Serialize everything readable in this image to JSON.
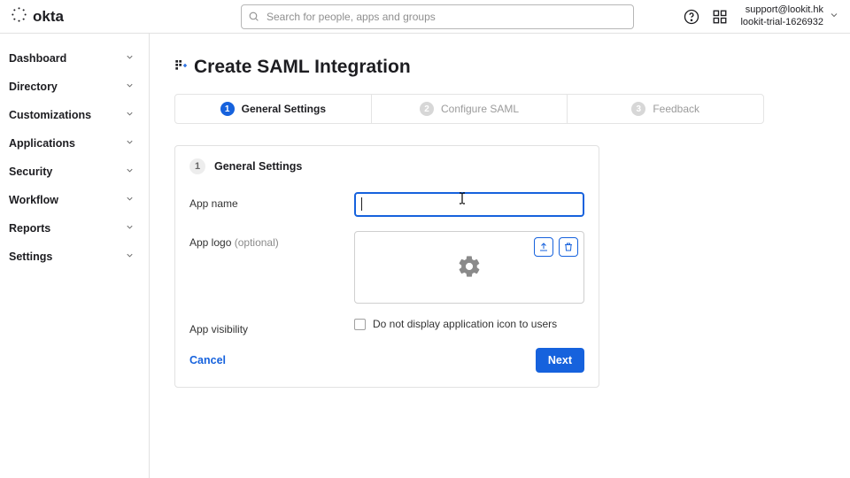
{
  "brand": "okta",
  "search": {
    "placeholder": "Search for people, apps and groups"
  },
  "user": {
    "email": "support@lookit.hk",
    "tenant": "lookit-trial-1626932"
  },
  "sidebar": {
    "items": [
      {
        "label": "Dashboard"
      },
      {
        "label": "Directory"
      },
      {
        "label": "Customizations"
      },
      {
        "label": "Applications"
      },
      {
        "label": "Security"
      },
      {
        "label": "Workflow"
      },
      {
        "label": "Reports"
      },
      {
        "label": "Settings"
      }
    ]
  },
  "page": {
    "title": "Create SAML Integration"
  },
  "stepper": {
    "steps": [
      {
        "num": "1",
        "label": "General Settings",
        "active": true
      },
      {
        "num": "2",
        "label": "Configure SAML",
        "active": false
      },
      {
        "num": "3",
        "label": "Feedback",
        "active": false
      }
    ]
  },
  "form": {
    "section_num": "1",
    "section_title": "General Settings",
    "app_name_label": "App name",
    "app_name_value": "",
    "app_logo_label": "App logo",
    "app_logo_hint": "(optional)",
    "app_visibility_label": "App visibility",
    "app_visibility_option": "Do not display application icon to users",
    "cancel_label": "Cancel",
    "next_label": "Next"
  }
}
